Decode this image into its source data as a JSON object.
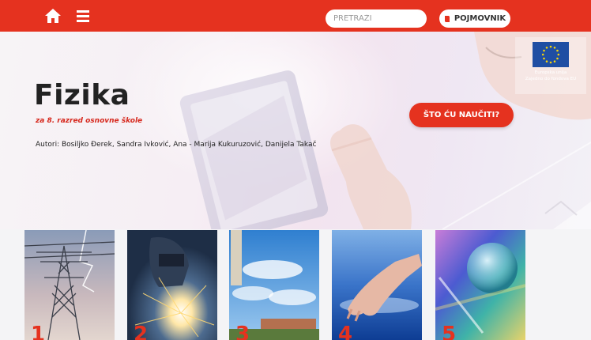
{
  "header": {
    "home_icon": "home-icon",
    "menu_icon": "hamburger-menu-icon",
    "search_placeholder": "PRETRAŽI",
    "glossary_label": "POJMOVNIK",
    "glossary_icon": "book-icon",
    "accent_color": "#e5321f"
  },
  "hero": {
    "title": "Fizika",
    "subtitle": "za 8. razred osnovne škole",
    "authors": "Autori: Bosiljko Đerek, Sandra Ivković, Ana - Marija Kukuruzović, Danijela Takač",
    "cta_label": "ŠTO ĆU NAUČITI?",
    "eu_line1": "Europska unija",
    "eu_line2": "Zajedno do fondova EU"
  },
  "units": [
    {
      "number": "1",
      "image": "power-line-tower"
    },
    {
      "number": "2",
      "image": "welder-sparks"
    },
    {
      "number": "3",
      "image": "leaning-tower-sky"
    },
    {
      "number": "4",
      "image": "hand-on-water"
    },
    {
      "number": "5",
      "image": "soap-bubble"
    }
  ]
}
